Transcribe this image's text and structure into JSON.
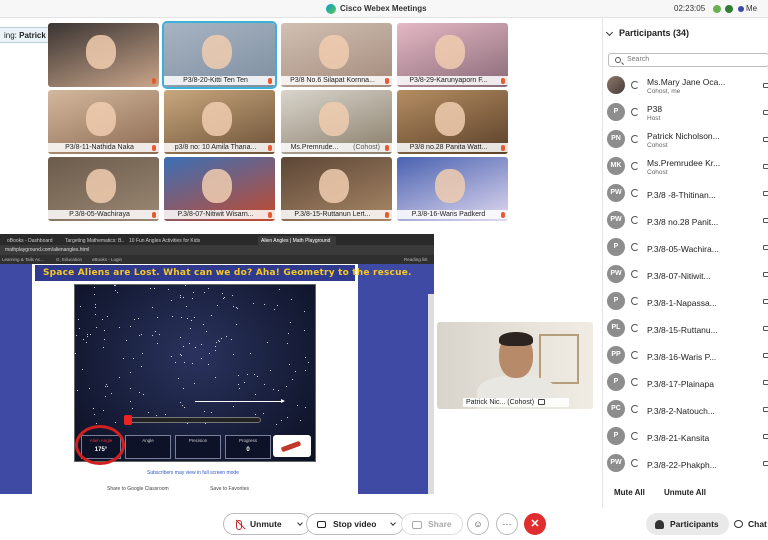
{
  "window": {
    "title": "Cisco Webex Meetings",
    "clock": "02:23:05",
    "right_label": "Me"
  },
  "share_banner": {
    "prefix": "ing: ",
    "name": "Patrick Nicholson Pardo (C..."
  },
  "tiles": [
    {
      "name": "",
      "active": false,
      "colors": [
        "#3a3432",
        "#c9a58a"
      ]
    },
    {
      "name": "P3/8-20-Kitti Ten Ten",
      "active": true,
      "colors": [
        "#a7b4c2",
        "#7f8fa1"
      ]
    },
    {
      "name": "P3/8 No.6 Silapat Kornna...",
      "active": false,
      "colors": [
        "#d1c0b3",
        "#a48b7c"
      ]
    },
    {
      "name": "P3/8-29-Karunyaporn F...",
      "active": false,
      "colors": [
        "#e4b8c4",
        "#8a6a78"
      ]
    },
    {
      "name": "P3/8-11-Nathida Naka",
      "active": false,
      "colors": [
        "#d3b89e",
        "#8d6b52"
      ]
    },
    {
      "name": "p3/8 no: 10 Amila Thana...",
      "active": false,
      "colors": [
        "#c7a77d",
        "#6e5238"
      ]
    },
    {
      "name": "Ms.Premrude...",
      "active": false,
      "role": "(Cohost)",
      "colors": [
        "#d9d5cd",
        "#8a7e6a"
      ]
    },
    {
      "name": "P3/8 no.28 Panita Watt...",
      "active": false,
      "colors": [
        "#b58d62",
        "#5b4129"
      ]
    },
    {
      "name": "P.3/8-05-Wachiraya",
      "active": false,
      "colors": [
        "#6b5b4a",
        "#9b8875"
      ]
    },
    {
      "name": "P.3/8-07-Nitiwit Wisarn...",
      "active": false,
      "colors": [
        "#3b6fb7",
        "#c44a2d"
      ]
    },
    {
      "name": "P.3/8-15-Ruttanun Lert...",
      "active": false,
      "colors": [
        "#5c4636",
        "#a88766"
      ]
    },
    {
      "name": "P.3/8-16-Waris Padkerd",
      "active": false,
      "colors": [
        "#4a62b0",
        "#e0d8f0"
      ]
    }
  ],
  "shared_screen": {
    "tabs": [
      "oBooks - Dashboard",
      "Targeting Mathematics: B...",
      "10 Fun Angles Activities for Kids",
      "Alien Angles | Math Playground"
    ],
    "url": "mathplayground.com/alienangles.html",
    "bookmarks": [
      "Learning & Tails Ac...",
      "G. Education",
      "eBooks - Login",
      "Reading list"
    ],
    "game_title": "Space Aliens are Lost. What can we do? Aha! Geometry to the rescue.",
    "panel": [
      {
        "label": "Alien Angle",
        "value": "175°",
        "red": true
      },
      {
        "label": "Angle",
        "value": "",
        "red": false
      },
      {
        "label": "Precision",
        "value": "",
        "red": false
      },
      {
        "label": "Progress",
        "value": "0",
        "red": false
      }
    ],
    "fullscreen_note": "Subscribers may view in full screen mode",
    "links": [
      "Share to Google Classroom",
      "Save to Favorites"
    ]
  },
  "self_view": {
    "name": "Patrick Nic...",
    "role": "(Cohost)"
  },
  "participants": {
    "title": "Participants (34)",
    "search_placeholder": "Search",
    "list": [
      {
        "initials": "",
        "name": "Ms.Mary Jane Oca...",
        "role": "Cohost, me",
        "photo": true
      },
      {
        "initials": "P",
        "name": "P38",
        "role": "Host"
      },
      {
        "initials": "PN",
        "name": "Patrick Nicholson...",
        "role": "Cohost"
      },
      {
        "initials": "MK",
        "name": "Ms.Premrudee Kr...",
        "role": "Cohost"
      },
      {
        "initials": "PW",
        "name": "P.3/8 -8-Thitinan...",
        "role": ""
      },
      {
        "initials": "PW",
        "name": "P.3/8 no.28 Panit...",
        "role": ""
      },
      {
        "initials": "P",
        "name": "P.3/8-05-Wachira...",
        "role": ""
      },
      {
        "initials": "PW",
        "name": "P.3/8-07-Nitiwit...",
        "role": ""
      },
      {
        "initials": "P",
        "name": "P.3/8-1-Napassa...",
        "role": ""
      },
      {
        "initials": "PL",
        "name": "P.3/8-15-Ruttanu...",
        "role": ""
      },
      {
        "initials": "PP",
        "name": "P.3/8-16-Waris P...",
        "role": ""
      },
      {
        "initials": "P",
        "name": "P.3/8-17-Plainapa",
        "role": ""
      },
      {
        "initials": "PC",
        "name": "P.3/8-2-Natouch...",
        "role": ""
      },
      {
        "initials": "P",
        "name": "P.3/8-21-Kansita",
        "role": ""
      },
      {
        "initials": "PW",
        "name": "P.3/8-22-Phakph...",
        "role": ""
      }
    ],
    "mute_all": "Mute All",
    "unmute_all": "Unmute All"
  },
  "toolbar": {
    "unmute": "Unmute",
    "stop_video": "Stop video",
    "share": "Share",
    "reactions_glyph": "☺",
    "more_glyph": "···",
    "end_glyph": "✕",
    "participants": "Participants",
    "chat": "Chat"
  }
}
